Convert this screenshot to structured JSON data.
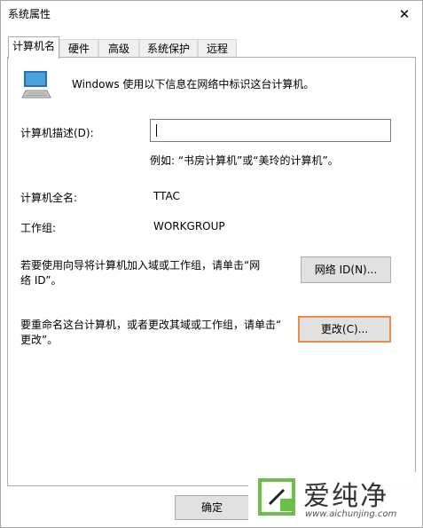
{
  "window": {
    "title": "系统属性",
    "close_glyph": "✕"
  },
  "tabs": [
    {
      "label": "计算机名"
    },
    {
      "label": "硬件"
    },
    {
      "label": "高级"
    },
    {
      "label": "系统保护"
    },
    {
      "label": "远程"
    }
  ],
  "intro": {
    "text": "Windows 使用以下信息在网络中标识这台计算机。",
    "icon": "computer-monitor-icon"
  },
  "description": {
    "label": "计算机描述(D):",
    "value": "",
    "example": "例如: “书房计算机”或“美玲的计算机”。"
  },
  "full_name": {
    "label": "计算机全名:",
    "value": "TTAC"
  },
  "workgroup": {
    "label": "工作组:",
    "value": "WORKGROUP"
  },
  "network_id": {
    "text_line1": "若要使用向导将计算机加入域或工作组，请单击“网",
    "text_line2": "络 ID”。",
    "button": "网络 ID(N)..."
  },
  "change": {
    "text_line1": "要重命名这台计算机，或者更改其域或工作组，请单击“",
    "text_line2": "更改”。",
    "button": "更改(C)..."
  },
  "footer": {
    "ok_button": "确定"
  },
  "watermark": {
    "text": "爱纯净",
    "url": "www.aichunjing.com"
  },
  "colors": {
    "focus_border": "#e88f4a",
    "button_face": "#e1e1e1",
    "monitor_screen": "#4aa3df"
  }
}
